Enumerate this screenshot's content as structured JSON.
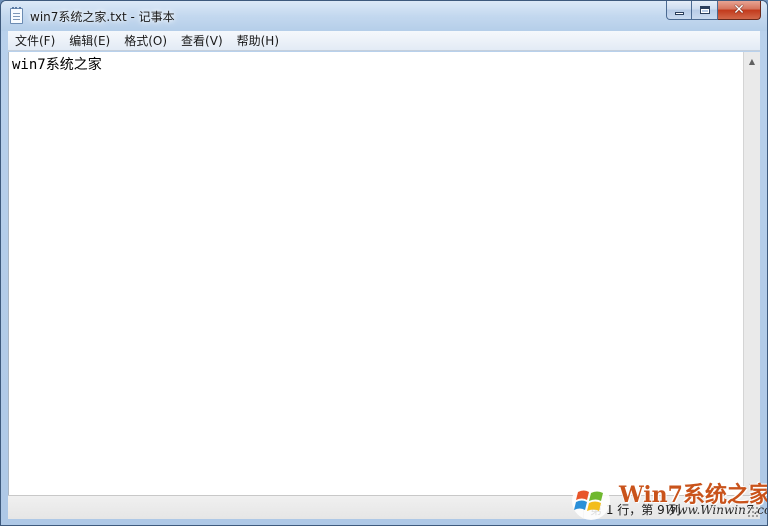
{
  "window": {
    "title": "win7系统之家.txt - 记事本"
  },
  "menu": {
    "items": [
      "文件(F)",
      "编辑(E)",
      "格式(O)",
      "查看(V)",
      "帮助(H)"
    ]
  },
  "editor": {
    "content": "win7系统之家"
  },
  "status": {
    "position": "第 1 行，第 9 列"
  },
  "watermark": {
    "title": "Win7系统之家",
    "url": "Www.Winwin7.com"
  },
  "icons": {
    "app": "notepad-icon",
    "minimize": "minimize-icon",
    "maximize": "maximize-icon",
    "close": "close-icon",
    "scroll_up": "scroll-up-arrow-icon",
    "scroll_down": "scroll-down-arrow-icon",
    "logo": "windows-flag-logo-icon"
  },
  "colors": {
    "close_button": "#c2391b",
    "watermark_title": "#c9531b"
  }
}
